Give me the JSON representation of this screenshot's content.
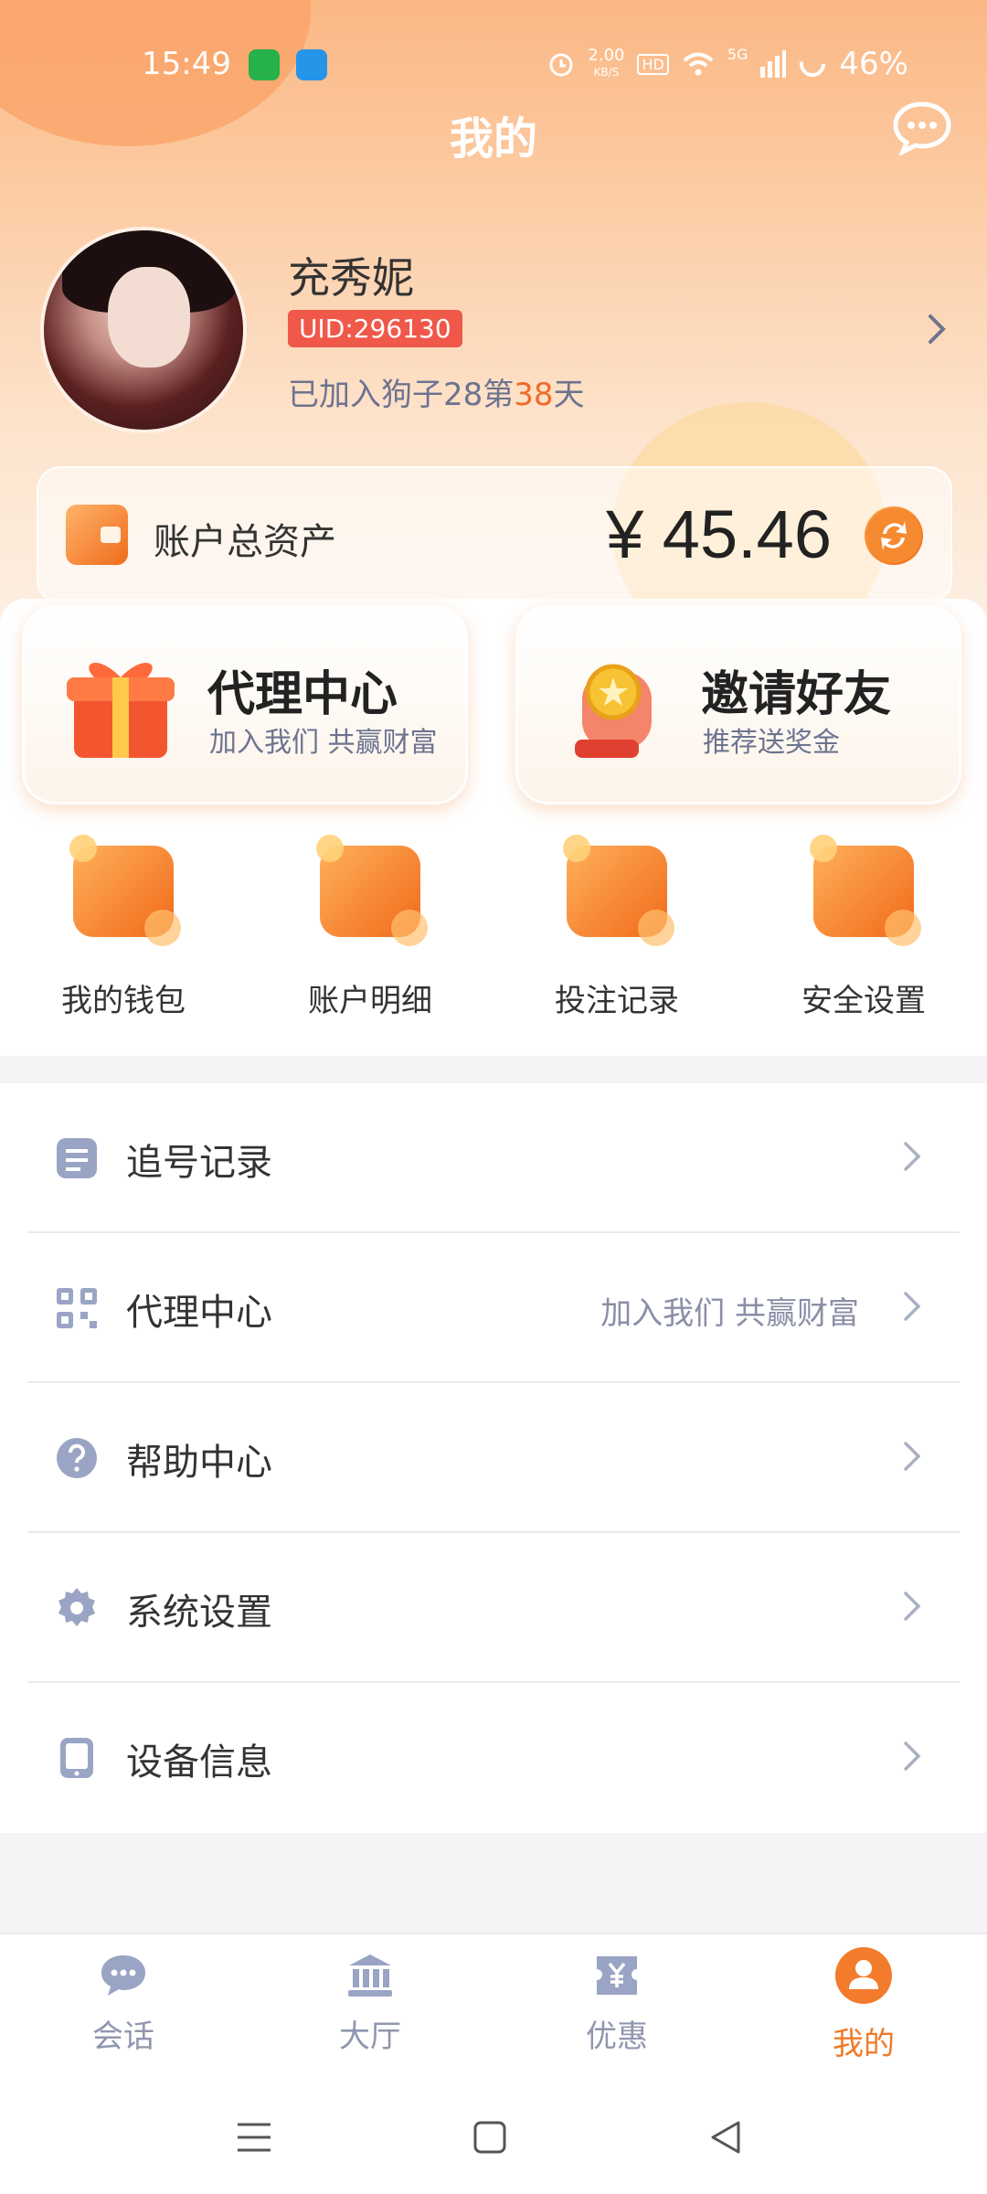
{
  "status_bar": {
    "time": "15:49",
    "net_speed": "2.00",
    "net_unit": "KB/S",
    "hd": "HD",
    "signal": "5G",
    "battery": "46%"
  },
  "header": {
    "title": "我的"
  },
  "profile": {
    "name": "充秀妮",
    "uid": "UID:296130",
    "joined_prefix": "已加入狗子28第",
    "joined_days": "38",
    "joined_suffix": "天"
  },
  "assets": {
    "label": "账户总资产",
    "value": "¥ 45.46"
  },
  "promos": [
    {
      "title": "代理中心",
      "subtitle": "加入我们 共赢财富"
    },
    {
      "title": "邀请好友",
      "subtitle": "推荐送奖金"
    }
  ],
  "quick_actions": [
    {
      "label": "我的钱包",
      "icon": "wallet-icon"
    },
    {
      "label": "账户明细",
      "icon": "magnifier-icon"
    },
    {
      "label": "投注记录",
      "icon": "calendar-icon"
    },
    {
      "label": "安全设置",
      "icon": "key-icon"
    }
  ],
  "menu": [
    {
      "label": "追号记录",
      "desc": "",
      "icon": "document-icon"
    },
    {
      "label": "代理中心",
      "desc": "加入我们 共赢财富",
      "icon": "qrcode-icon"
    },
    {
      "label": "帮助中心",
      "desc": "",
      "icon": "question-icon"
    },
    {
      "label": "系统设置",
      "desc": "",
      "icon": "gear-icon"
    },
    {
      "label": "设备信息",
      "desc": "",
      "icon": "tablet-icon"
    }
  ],
  "tabs": [
    {
      "label": "会话",
      "icon": "chat-icon",
      "active": false
    },
    {
      "label": "大厅",
      "icon": "bank-icon",
      "active": false
    },
    {
      "label": "优惠",
      "icon": "yen-ticket-icon",
      "active": false
    },
    {
      "label": "我的",
      "icon": "user-icon",
      "active": true
    }
  ],
  "colors": {
    "accent": "#f07a2a",
    "uid_badge": "#f0584a",
    "muted": "#8a8fa6"
  }
}
